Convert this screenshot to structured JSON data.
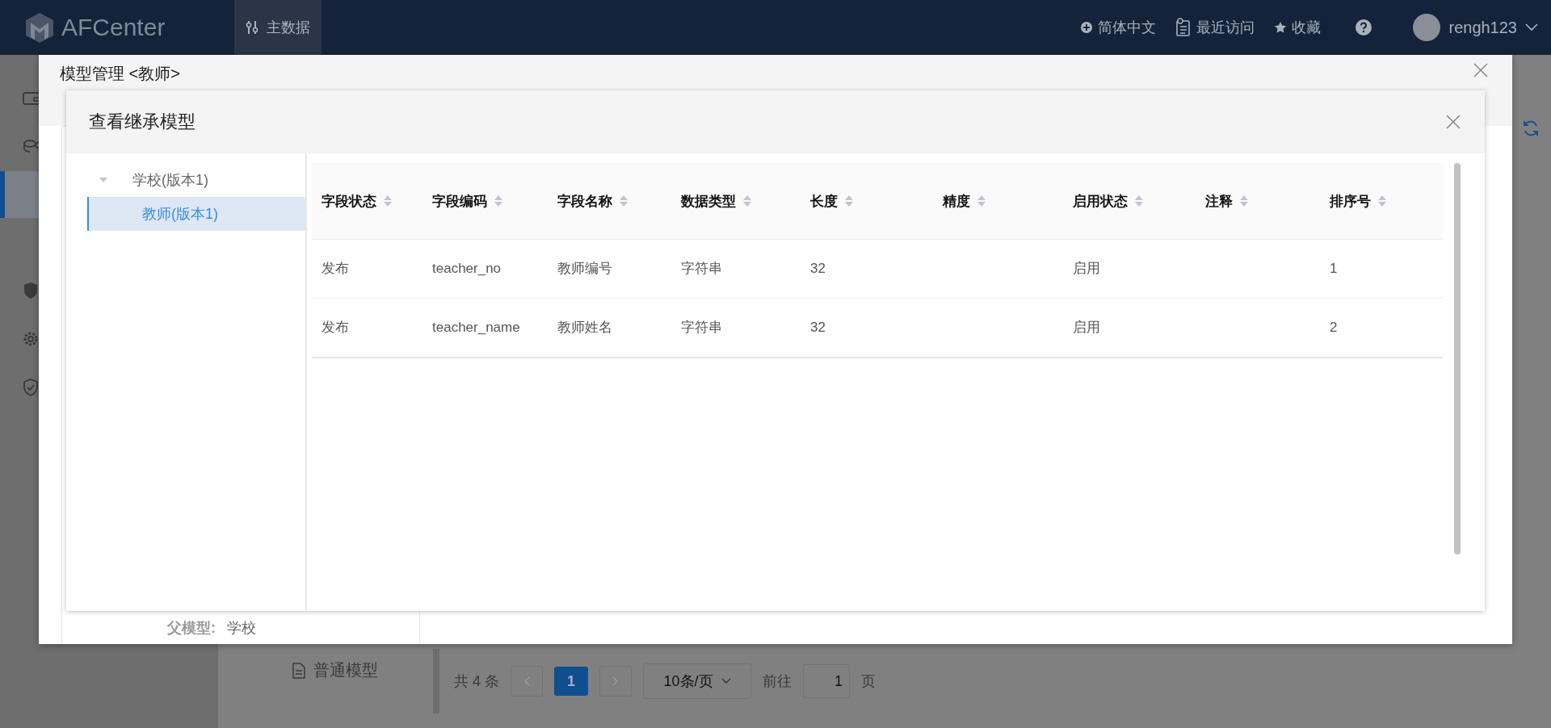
{
  "topbar": {
    "logo": "AFCenter",
    "nav": [
      {
        "label": "主数据",
        "selected": true
      }
    ],
    "language": "简体中文",
    "recent": "最近访问",
    "favorites": "收藏",
    "user": "rengh123"
  },
  "background": {
    "parent_model_label": "父模型:",
    "parent_model_value": "学校",
    "model_type": "普通模型",
    "pagination": {
      "total": "共 4 条",
      "pages": [
        {
          "label": "1",
          "selected": true
        }
      ],
      "page_size": "10条/页",
      "goto_label": "前往",
      "goto_value": "1",
      "goto_suffix": "页"
    }
  },
  "outer_dialog": {
    "title": "模型管理 <教师>"
  },
  "dialog": {
    "title": "查看继承模型",
    "tree": [
      {
        "label": "学校(版本1)",
        "expanded": true,
        "selected": false,
        "children": [
          {
            "label": "教师(版本1)",
            "selected": true
          }
        ]
      }
    ],
    "table": {
      "columns": [
        "字段状态",
        "字段编码",
        "字段名称",
        "数据类型",
        "长度",
        "精度",
        "启用状态",
        "注释",
        "排序号"
      ],
      "rows": [
        [
          "发布",
          "teacher_no",
          "教师编号",
          "字符串",
          "32",
          null,
          "启用",
          null,
          "1"
        ],
        [
          "发布",
          "teacher_name",
          "教师姓名",
          "字符串",
          "32",
          null,
          "启用",
          null,
          "2"
        ]
      ]
    }
  }
}
